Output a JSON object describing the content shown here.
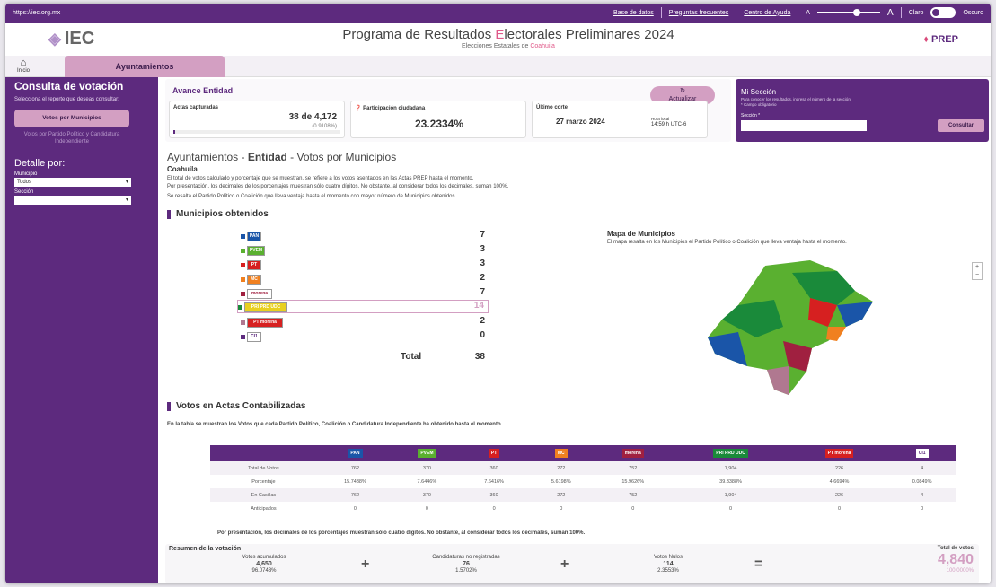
{
  "topbar": {
    "url": "https://iec.org.mx",
    "links": [
      "Base de datos",
      "Preguntas frecuentes",
      "Centro de Ayuda"
    ],
    "font_small": "A",
    "font_large": "A",
    "theme_light": "Claro",
    "theme_dark": "Oscuro"
  },
  "header": {
    "logo": "IEC",
    "title_prefix": "Programa de Resultados ",
    "title_accent": "E",
    "title_suffix": "lectorales Preliminares 2024",
    "subtitle_prefix": "Elecciones Estatales de ",
    "subtitle_accent": "Coahuila",
    "prep": "PREP"
  },
  "nav": {
    "home": "Inicio",
    "tab": "Ayuntamientos"
  },
  "sidebar": {
    "title": "Consulta de votación",
    "prompt": "Selecciona el reporte que deseas consultar:",
    "active": "Votos por Municipios",
    "disabled": "Votos por Partido Político y Candidatura Independiente",
    "detail": "Detalle por:",
    "municipio_label": "Municipio",
    "municipio_value": "Todos",
    "seccion_label": "Sección",
    "seccion_value": ""
  },
  "avance": {
    "title": "Avance Entidad",
    "refresh": "Actualizar",
    "actas_label": "Actas capturadas",
    "actas_value": "38 de 4,172",
    "actas_pct": "(0.9108%)",
    "part_label": "Participación ciudadana",
    "part_value": "23.2334%",
    "corte_label": "Último corte",
    "corte_date": "27 marzo 2024",
    "corte_hora": "Hora local",
    "corte_time": "14:59 h UTC-6",
    "progress": 0.009108
  },
  "mi_seccion": {
    "title": "Mi Sección",
    "hint": "Para conocer los resultados, ingresa el número de la sección.",
    "required": "* Campo obligatorio",
    "label": "Sección *",
    "button": "Consultar"
  },
  "content": {
    "title_a": "Ayuntamientos - ",
    "title_b": "Entidad",
    "title_c": " - Votos por Municipios",
    "state": "Coahuila",
    "p1": "El total de votos calculado y porcentaje que se muestran, se refiere a los votos asentados en las Actas PREP hasta el momento.",
    "p2": "Por presentación, los decimales de los porcentajes muestran sólo cuatro dígitos. No obstante, al considerar todos los decimales, suman 100%.",
    "p3": "Se resalta el Partido Político o Coalición que lleva ventaja hasta el momento con mayor número de Municipios obtenidos."
  },
  "municipios": {
    "title": "Municipios obtenidos",
    "total_label": "Total",
    "total": "38",
    "rows": [
      {
        "logo": "PAN",
        "bg": "#1a55a8",
        "color": "#1a55a8",
        "count": "7"
      },
      {
        "logo": "PVEM",
        "bg": "#5ab030",
        "color": "#5ab030",
        "count": "3"
      },
      {
        "logo": "PT",
        "bg": "#d62020",
        "color": "#d62020",
        "count": "3"
      },
      {
        "logo": "MC",
        "bg": "#f08020",
        "color": "#f08020",
        "count": "2"
      },
      {
        "logo": "morena",
        "bg": "#fff",
        "color": "#a02040",
        "count": "7"
      },
      {
        "logo": "PRI PRD UDC",
        "bg": "#e8d020",
        "color": "#1a8a3a",
        "count": "14"
      },
      {
        "logo": "PT morena",
        "bg": "#d62020",
        "color": "#b07890",
        "count": "2"
      },
      {
        "logo": "CI1",
        "bg": "#fff",
        "color": "#5d2a7e",
        "count": "0"
      }
    ]
  },
  "mapa": {
    "title": "Mapa de Municipios",
    "desc": "El mapa resalta en los Municipios el Partido Político o Coalición que lleva ventaja hasta el momento.",
    "zoom_in": "+",
    "zoom_out": "−"
  },
  "votos": {
    "title": "Votos en Actas Contabilizadas",
    "desc": "En la tabla se muestran los Votos que cada Partido Político, Coalición o Candidatura Independiente ha obtenido hasta el momento.",
    "headers": [
      {
        "t": "PAN",
        "bg": "#1a55a8"
      },
      {
        "t": "PVEM",
        "bg": "#5ab030"
      },
      {
        "t": "PT",
        "bg": "#d62020"
      },
      {
        "t": "MC",
        "bg": "#f08020"
      },
      {
        "t": "morena",
        "bg": "#a02040"
      },
      {
        "t": "PRI PRD UDC",
        "bg": "#1a8a3a"
      },
      {
        "t": "PT morena",
        "bg": "#d62020"
      },
      {
        "t": "CI1",
        "bg": "#fff"
      }
    ],
    "rows": [
      {
        "label": "Total de Votos",
        "v": [
          "762",
          "370",
          "360",
          "272",
          "752",
          "1,904",
          "226",
          "4"
        ]
      },
      {
        "label": "Porcentaje",
        "v": [
          "15.7438%",
          "7.6446%",
          "7.6416%",
          "5.6198%",
          "15.9626%",
          "39.3388%",
          "4.6694%",
          "0.0849%"
        ]
      },
      {
        "label": "En Casillas",
        "v": [
          "762",
          "370",
          "360",
          "272",
          "752",
          "1,904",
          "226",
          "4"
        ]
      },
      {
        "label": "Anticipados",
        "v": [
          "0",
          "0",
          "0",
          "0",
          "0",
          "0",
          "0",
          "0"
        ]
      }
    ],
    "note": "Por presentación, los decimales de los porcentajes muestran sólo cuatro dígitos. No obstante, al considerar todos los decimales, suman 100%."
  },
  "resumen": {
    "title": "Resumen de la votación",
    "acum_label": "Votos acumulados",
    "acum": "4,650",
    "acum_pct": "96.0743%",
    "noreg_label": "Candidaturas no registradas",
    "noreg": "76",
    "noreg_pct": "1.5702%",
    "nulos_label": "Votos Nulos",
    "nulos": "114",
    "nulos_pct": "2.3553%",
    "total_label": "Total de votos",
    "total": "4,840",
    "total_pct": "100.0000%",
    "plus": "+",
    "equals": "="
  }
}
